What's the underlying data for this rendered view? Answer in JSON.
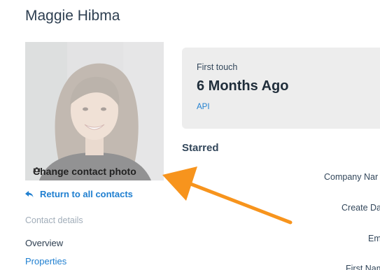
{
  "contact": {
    "name": "Maggie Hibma",
    "change_photo_label": "Change contact photo",
    "return_label": "Return to all contacts"
  },
  "sidebar": {
    "section_label": "Contact details",
    "items": [
      {
        "label": "Overview"
      },
      {
        "label": "Properties"
      }
    ]
  },
  "first_touch": {
    "label": "First touch",
    "value": "6 Months Ago",
    "source": "API"
  },
  "starred": {
    "title": "Starred",
    "properties": [
      {
        "label": "Company Nar"
      },
      {
        "label": "Create Da"
      },
      {
        "label": "Em"
      },
      {
        "label": "First Nam"
      }
    ]
  },
  "colors": {
    "accent": "#1f7fd0",
    "annotation_arrow": "#f7941d",
    "card_bg": "#ededed"
  },
  "icons": {
    "camera": "camera-icon",
    "back": "back-arrow-icon"
  }
}
